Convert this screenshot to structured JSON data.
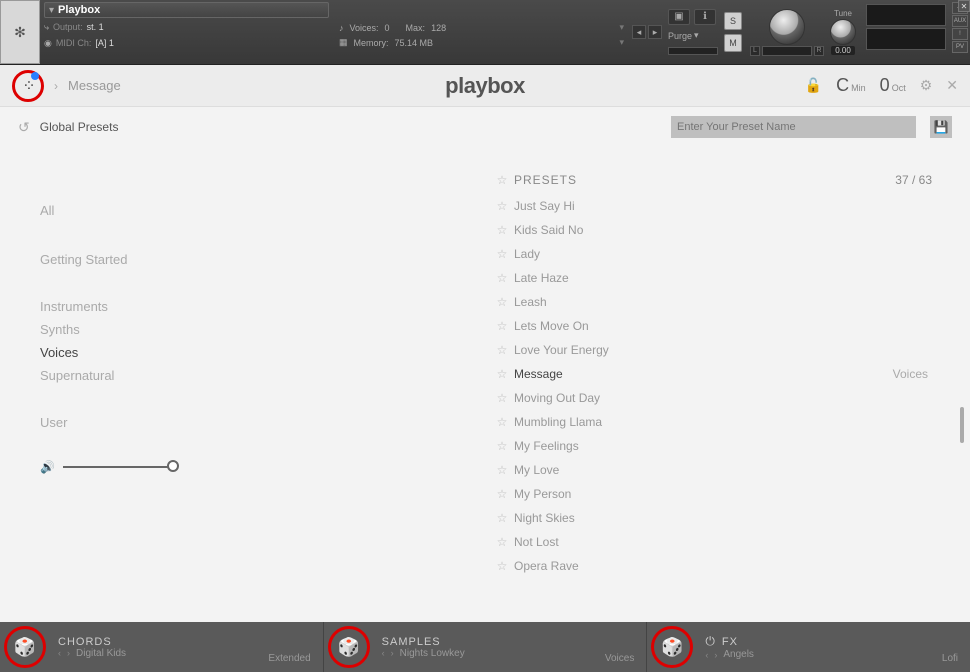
{
  "kontakt": {
    "instrument_name": "Playbox",
    "output_label": "Output:",
    "output_value": "st. 1",
    "midi_label": "MIDI Ch:",
    "midi_value": "[A] 1",
    "voices_label": "Voices:",
    "voices_value": "0",
    "max_label": "Max:",
    "max_value": "128",
    "memory_label": "Memory:",
    "memory_value": "75.14 MB",
    "purge": "Purge",
    "tune_label": "Tune",
    "tune_value": "0.00",
    "solo": "S",
    "mute": "M",
    "lr_l": "L",
    "lr_r": "R",
    "aux": "AUX",
    "pv": "PV",
    "exclaim": "!"
  },
  "breadcrumb": {
    "current_preset": "Message",
    "logo": "playbox",
    "key_note": "C",
    "key_mode": "Min",
    "oct_num": "0",
    "oct_label": "Oct"
  },
  "globals": {
    "label": "Global Presets",
    "input_placeholder": "Enter Your Preset Name"
  },
  "categories": [
    "All",
    "Getting Started",
    "Instruments",
    "Synths",
    "Voices",
    "Supernatural",
    "User"
  ],
  "active_category": "Voices",
  "presets_header": "PRESETS",
  "presets_count": "37 / 63",
  "presets": [
    {
      "name": "Just Say Hi"
    },
    {
      "name": "Kids Said No"
    },
    {
      "name": "Lady"
    },
    {
      "name": "Late Haze"
    },
    {
      "name": "Leash"
    },
    {
      "name": "Lets Move On"
    },
    {
      "name": "Love Your Energy"
    },
    {
      "name": "Message",
      "active": true,
      "tag": "Voices"
    },
    {
      "name": "Moving Out Day"
    },
    {
      "name": "Mumbling Llama"
    },
    {
      "name": "My Feelings"
    },
    {
      "name": "My Love"
    },
    {
      "name": "My Person"
    },
    {
      "name": "Night Skies"
    },
    {
      "name": "Not Lost"
    },
    {
      "name": "Opera Rave"
    }
  ],
  "bottom": {
    "chords": {
      "title": "CHORDS",
      "value": "Digital Kids",
      "right": "Extended"
    },
    "samples": {
      "title": "SAMPLES",
      "value": "Nights Lowkey",
      "right": "Voices"
    },
    "fx": {
      "title": "FX",
      "value": "Angels",
      "right": "Lofi"
    }
  }
}
